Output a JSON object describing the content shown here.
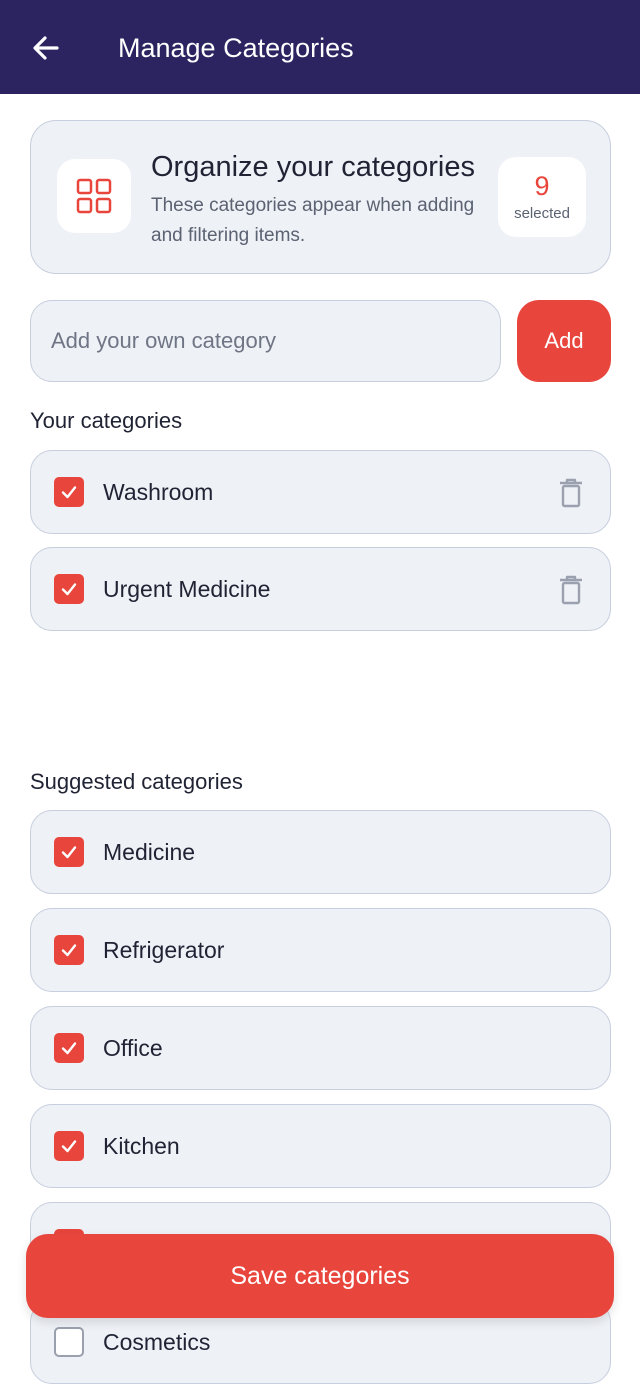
{
  "appbar": {
    "title": "Manage Categories",
    "back_icon": "arrow-left-icon"
  },
  "intro": {
    "title": "Organize your categories",
    "description": "These categories appear when adding and filtering items.",
    "icon": "grid-icon",
    "count": "9",
    "count_label": "selected"
  },
  "add": {
    "placeholder": "Add your own category",
    "value": "",
    "button_label": "Add"
  },
  "your_categories": {
    "heading": "Your categories",
    "items": [
      {
        "label": "Washroom",
        "checked": true
      },
      {
        "label": "Urgent Medicine",
        "checked": true
      }
    ]
  },
  "suggested_categories": {
    "heading": "Suggested categories",
    "items": [
      {
        "label": "Medicine",
        "checked": true
      },
      {
        "label": "Refrigerator",
        "checked": true
      },
      {
        "label": "Office",
        "checked": true
      },
      {
        "label": "Kitchen",
        "checked": true
      },
      {
        "label": "",
        "checked": true
      },
      {
        "label": "Cosmetics",
        "checked": false
      }
    ]
  },
  "save": {
    "label": "Save categories"
  },
  "colors": {
    "header": "#2c2460",
    "accent": "#e8453c",
    "card": "#eef1f6",
    "border": "#c7cedd"
  }
}
